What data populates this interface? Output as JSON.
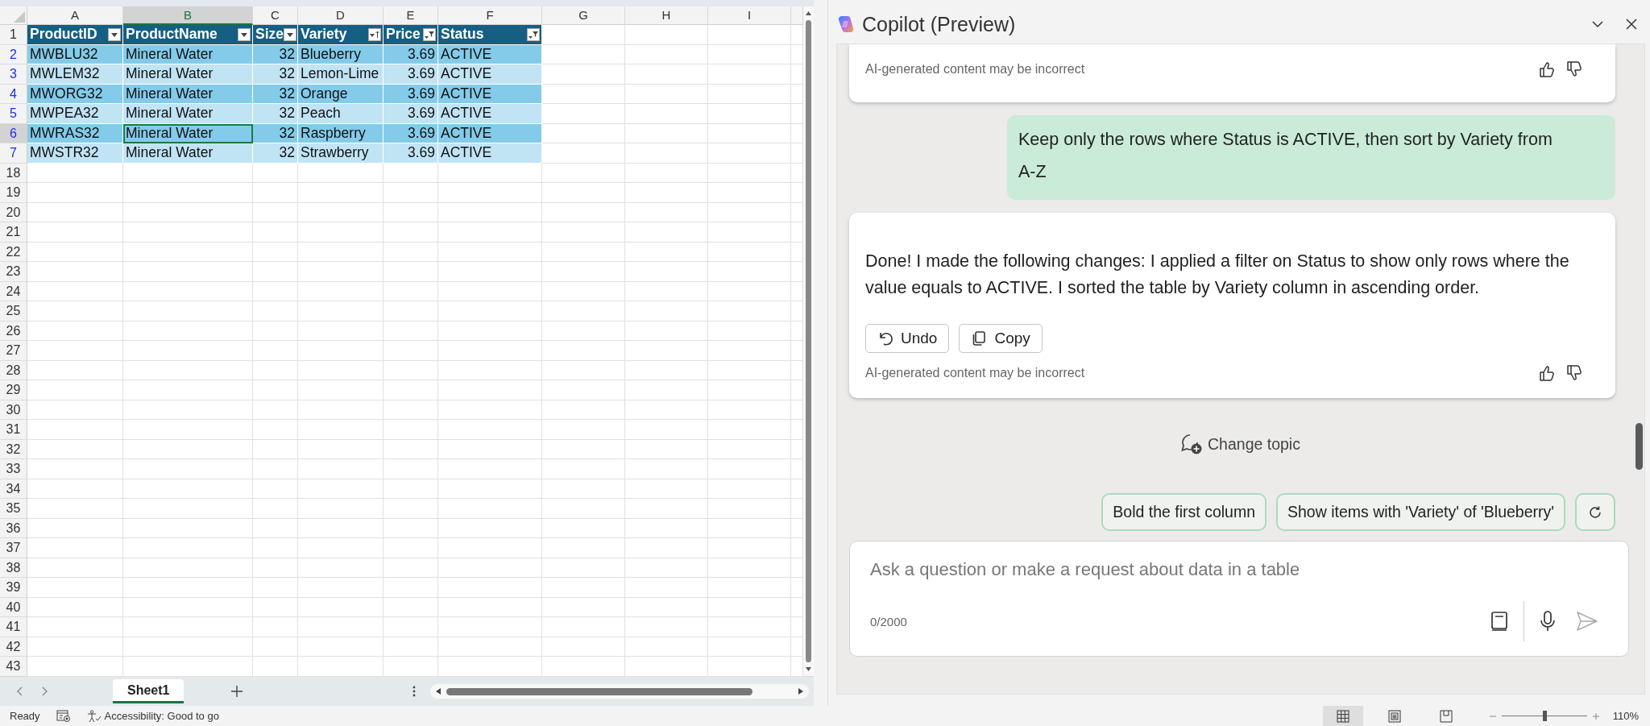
{
  "sheet": {
    "columns": [
      {
        "letter": "A",
        "selected": false
      },
      {
        "letter": "B",
        "selected": true
      },
      {
        "letter": "C",
        "selected": false
      },
      {
        "letter": "D",
        "selected": false
      },
      {
        "letter": "E",
        "selected": false
      },
      {
        "letter": "F",
        "selected": false
      },
      {
        "letter": "G",
        "selected": false
      },
      {
        "letter": "H",
        "selected": false
      },
      {
        "letter": "I",
        "selected": false
      }
    ],
    "table": {
      "header_row": "1",
      "headers": [
        {
          "text": "ProductID",
          "numeric": false,
          "kind": "dropdown"
        },
        {
          "text": "ProductName",
          "numeric": false,
          "kind": "dropdown"
        },
        {
          "text": "Size",
          "numeric": true,
          "kind": "dropdown"
        },
        {
          "text": "Variety",
          "numeric": false,
          "kind": "sorted"
        },
        {
          "text": "Price",
          "numeric": true,
          "kind": "filtered"
        },
        {
          "text": "Status",
          "numeric": false,
          "kind": "filtered"
        }
      ],
      "rows": [
        {
          "number": "2",
          "filtered": true,
          "selected": false,
          "cells": [
            "MWBLU32",
            "Mineral Water",
            "32",
            "Blueberry",
            "3.69",
            "ACTIVE"
          ]
        },
        {
          "number": "3",
          "filtered": true,
          "selected": false,
          "cells": [
            "MWLEM32",
            "Mineral Water",
            "32",
            "Lemon-Lime",
            "3.69",
            "ACTIVE"
          ]
        },
        {
          "number": "4",
          "filtered": true,
          "selected": false,
          "cells": [
            "MWORG32",
            "Mineral Water",
            "32",
            "Orange",
            "3.69",
            "ACTIVE"
          ]
        },
        {
          "number": "5",
          "filtered": true,
          "selected": false,
          "cells": [
            "MWPEA32",
            "Mineral Water",
            "32",
            "Peach",
            "3.69",
            "ACTIVE"
          ]
        },
        {
          "number": "6",
          "filtered": true,
          "selected": true,
          "cells": [
            "MWRAS32",
            "Mineral Water",
            "32",
            "Raspberry",
            "3.69",
            "ACTIVE"
          ]
        },
        {
          "number": "7",
          "filtered": true,
          "selected": false,
          "cells": [
            "MWSTR32",
            "Mineral Water",
            "32",
            "Strawberry",
            "3.69",
            "ACTIVE"
          ]
        }
      ]
    },
    "blank_rows": [
      "18",
      "19",
      "20",
      "21",
      "22",
      "23",
      "24",
      "25",
      "26",
      "27",
      "28",
      "29",
      "30",
      "31",
      "32",
      "33",
      "34",
      "35",
      "36",
      "37",
      "38",
      "39",
      "40",
      "41",
      "42",
      "43"
    ],
    "sheet_tabs": [
      {
        "label": "Sheet1",
        "selected": true
      }
    ]
  },
  "copilot": {
    "title": "Copilot (Preview)",
    "messages": [
      {
        "kind": "assistant",
        "disclaimer": "AI-generated content may be incorrect"
      },
      {
        "kind": "user",
        "text": "Keep only the rows where Status is ACTIVE, then sort by Variety from A-Z"
      },
      {
        "kind": "assistant",
        "text": "Done! I made the following changes: I applied a filter on Status to show only rows where the value equals to ACTIVE. I sorted the table by Variety column in ascending order.",
        "actions": [
          {
            "kind": "undo",
            "label": "Undo"
          },
          {
            "kind": "copy",
            "label": "Copy"
          }
        ],
        "disclaimer": "AI-generated content may be incorrect"
      }
    ],
    "change_topic": "Change topic",
    "suggestions": [
      "Bold the first column",
      "Show items with 'Variety' of 'Blueberry'"
    ],
    "input": {
      "placeholder": "Ask a question or make a request about data in a table",
      "counter": "0/2000"
    }
  },
  "status_bar": {
    "ready": "Ready",
    "accessibility": "Accessibility: Good to go",
    "views": [
      {
        "kind": "normal",
        "selected": true
      },
      {
        "kind": "page_layout",
        "selected": false
      },
      {
        "kind": "page_break",
        "selected": false
      }
    ],
    "zoom": {
      "level": 0.5,
      "reading": "110%"
    }
  }
}
